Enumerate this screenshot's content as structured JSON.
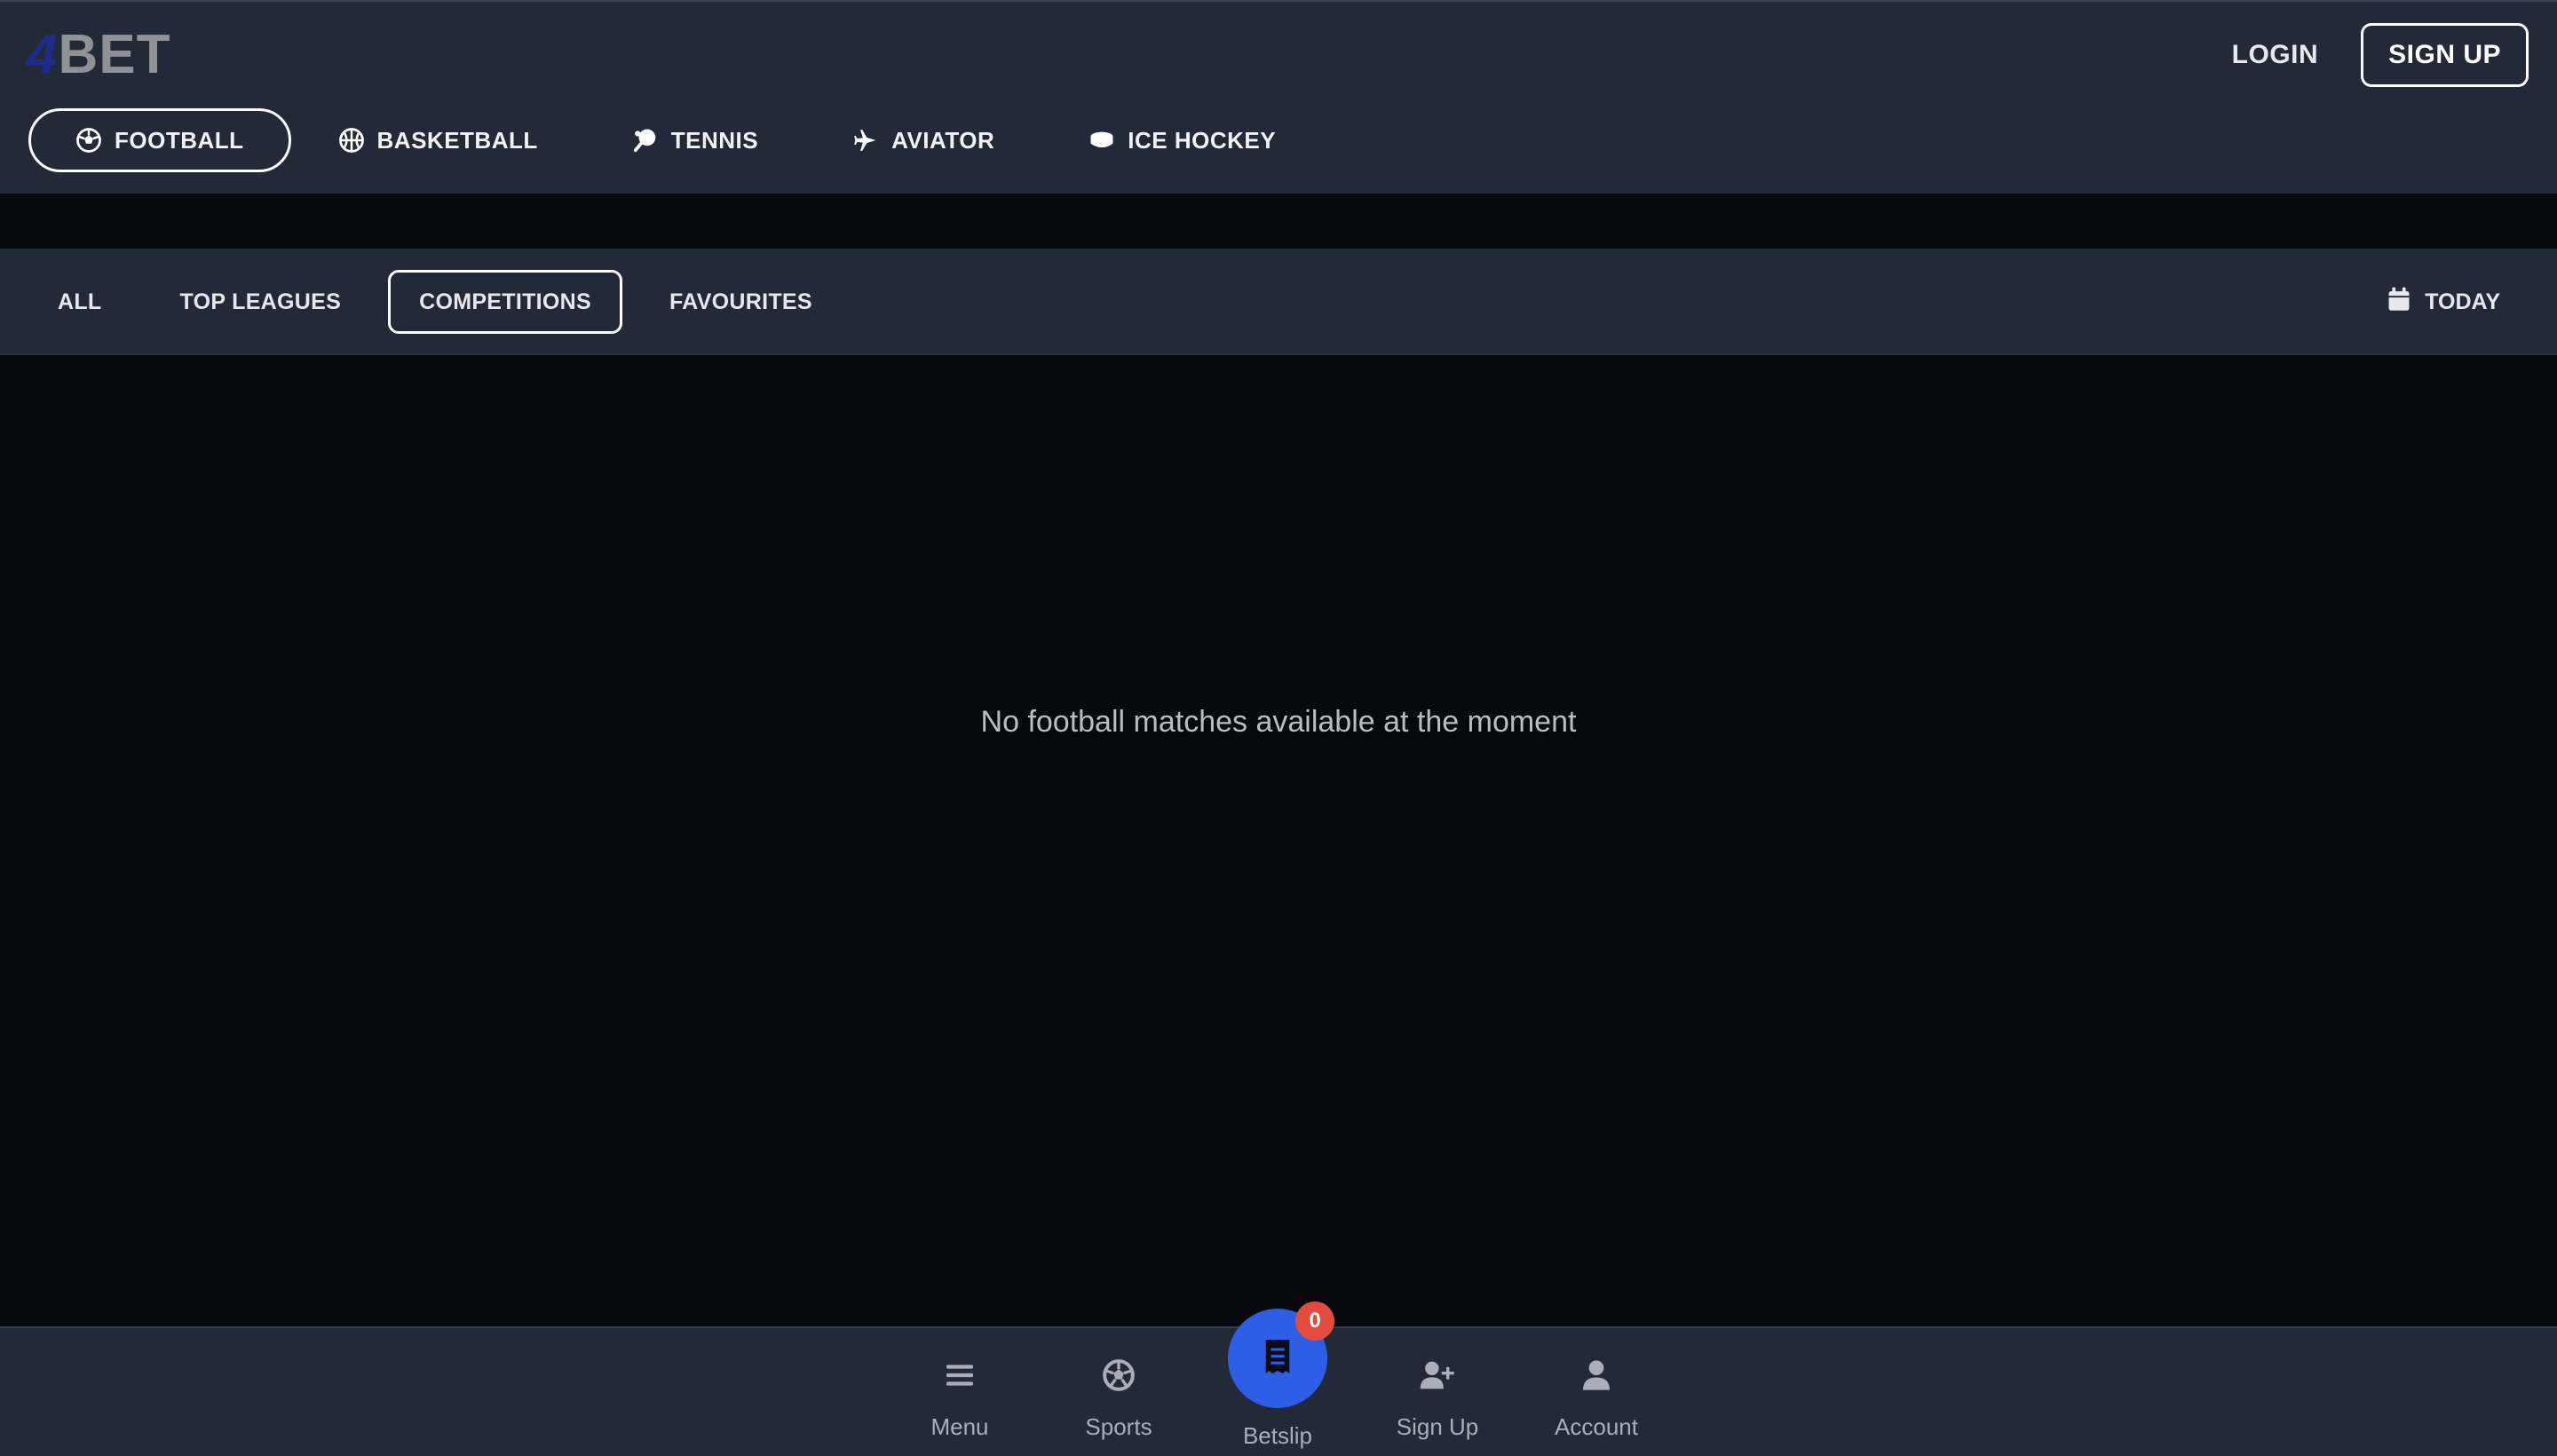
{
  "brand": {
    "logo_part1": "4",
    "logo_part2": "BET"
  },
  "auth": {
    "login_label": "LOGIN",
    "signup_label": "SIGN UP"
  },
  "sports": [
    {
      "label": "FOOTBALL",
      "icon": "football-icon",
      "active": true
    },
    {
      "label": "BASKETBALL",
      "icon": "basketball-icon",
      "active": false
    },
    {
      "label": "TENNIS",
      "icon": "tennis-icon",
      "active": false
    },
    {
      "label": "AVIATOR",
      "icon": "plane-icon",
      "active": false
    },
    {
      "label": "ICE HOCKEY",
      "icon": "hockey-puck-icon",
      "active": false
    }
  ],
  "filters": [
    {
      "label": "ALL",
      "active": false
    },
    {
      "label": "TOP LEAGUES",
      "active": false
    },
    {
      "label": "COMPETITIONS",
      "active": true
    },
    {
      "label": "FAVOURITES",
      "active": false
    }
  ],
  "date_filter": {
    "label": "TODAY",
    "icon": "calendar-icon"
  },
  "main": {
    "empty_message": "No football matches available at the moment"
  },
  "bottom_nav": {
    "menu_label": "Menu",
    "sports_label": "Sports",
    "betslip_label": "Betslip",
    "betslip_count": "0",
    "signup_label": "Sign Up",
    "account_label": "Account"
  },
  "colors": {
    "header_bg": "#222a38",
    "page_bg": "#07080b",
    "accent_blue": "#2f5ee6",
    "badge_red": "#e54a3f",
    "logo_blue": "#1d2c8c"
  }
}
